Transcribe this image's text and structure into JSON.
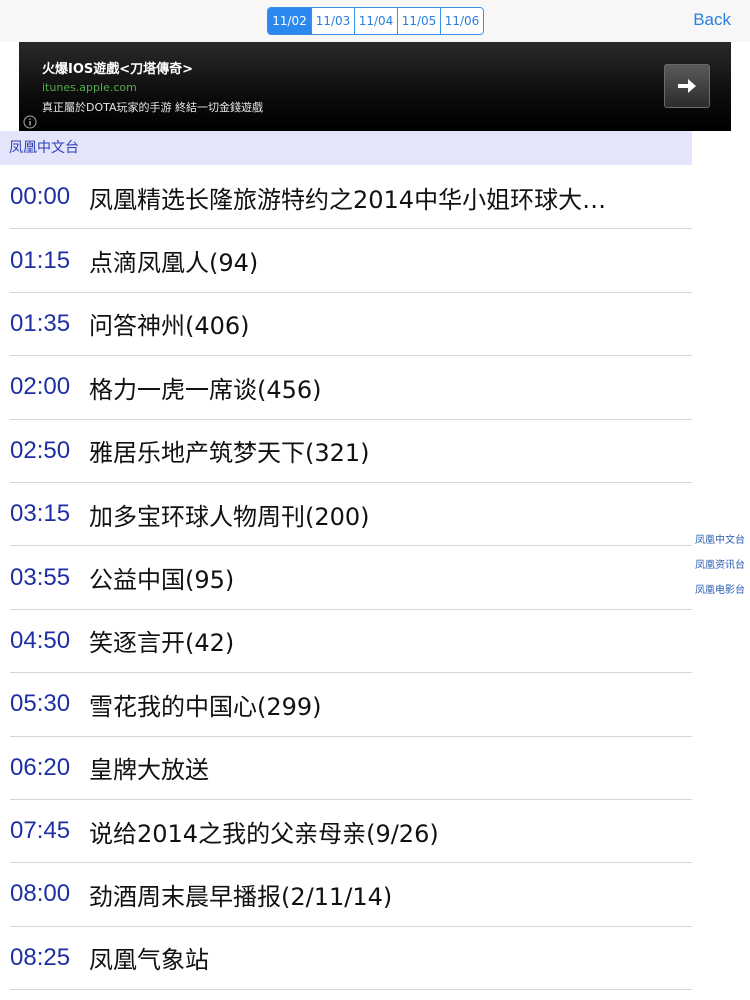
{
  "topbar": {
    "date_tabs": [
      "11/02",
      "11/03",
      "11/04",
      "11/05",
      "11/06"
    ],
    "active_tab": "11/02",
    "back_label": "Back"
  },
  "ad": {
    "title": "火爆IOS遊戲<刀塔傳奇>",
    "url": "itunes.apple.com",
    "description": "真正屬於DOTA玩家的手游 終結一切金錢遊戲"
  },
  "channel": {
    "name": "凤凰中文台"
  },
  "programs": [
    {
      "time": "00:00",
      "title": "凤凰精选长隆旅游特约之2014中华小姐环球大…"
    },
    {
      "time": "01:15",
      "title": "点滴凤凰人(94)"
    },
    {
      "time": "01:35",
      "title": "问答神州(406)"
    },
    {
      "time": "02:00",
      "title": "格力一虎一席谈(456)"
    },
    {
      "time": "02:50",
      "title": "雅居乐地产筑梦天下(321)"
    },
    {
      "time": "03:15",
      "title": "加多宝环球人物周刊(200)"
    },
    {
      "time": "03:55",
      "title": "公益中国(95)"
    },
    {
      "time": "04:50",
      "title": "笑逐言开(42)"
    },
    {
      "time": "05:30",
      "title": "雪花我的中国心(299)"
    },
    {
      "time": "06:20",
      "title": "皇牌大放送"
    },
    {
      "time": "07:45",
      "title": "说给2014之我的父亲母亲(9/26)"
    },
    {
      "time": "08:00",
      "title": "劲酒周末晨早播报(2/11/14)"
    },
    {
      "time": "08:25",
      "title": "凤凰气象站"
    }
  ],
  "side_channels": [
    "凤凰中文台",
    "凤凰资讯台",
    "凤凰电影台"
  ],
  "colors": {
    "accent": "#2a88ef",
    "time_text": "#1e2fa3",
    "header_bg": "#e4e5fb"
  }
}
